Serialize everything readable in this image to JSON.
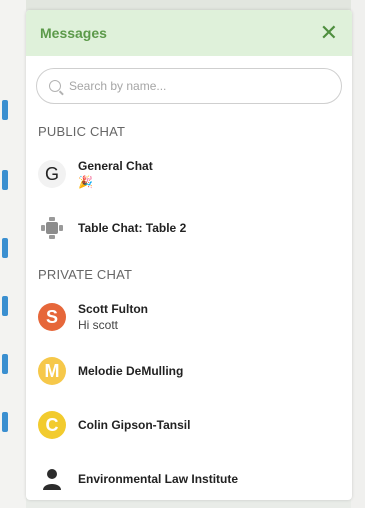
{
  "panel": {
    "title": "Messages",
    "close_symbol": "✕"
  },
  "search": {
    "placeholder": "Search by name..."
  },
  "sections": {
    "public": {
      "title": "PUBLIC CHAT"
    },
    "private": {
      "title": "PRIVATE CHAT"
    }
  },
  "public_chats": [
    {
      "avatar_letter": "G",
      "name": "General Chat",
      "sub": "🎉"
    },
    {
      "avatar_letter": "",
      "name": "Table Chat: Table 2",
      "sub": ""
    }
  ],
  "private_chats": [
    {
      "avatar_letter": "S",
      "name": "Scott Fulton",
      "sub": "Hi scott"
    },
    {
      "avatar_letter": "M",
      "name": "Melodie DeMulling",
      "sub": ""
    },
    {
      "avatar_letter": "C",
      "name": "Colin Gipson-Tansil",
      "sub": ""
    },
    {
      "avatar_letter": "",
      "name": "Environmental Law Institute",
      "sub": ""
    }
  ],
  "colors": {
    "header_bg": "#dff1da",
    "header_text": "#5c9a4a",
    "avatar_s": "#e6673a",
    "avatar_m": "#f6c84a",
    "avatar_c": "#f2cb2e"
  }
}
